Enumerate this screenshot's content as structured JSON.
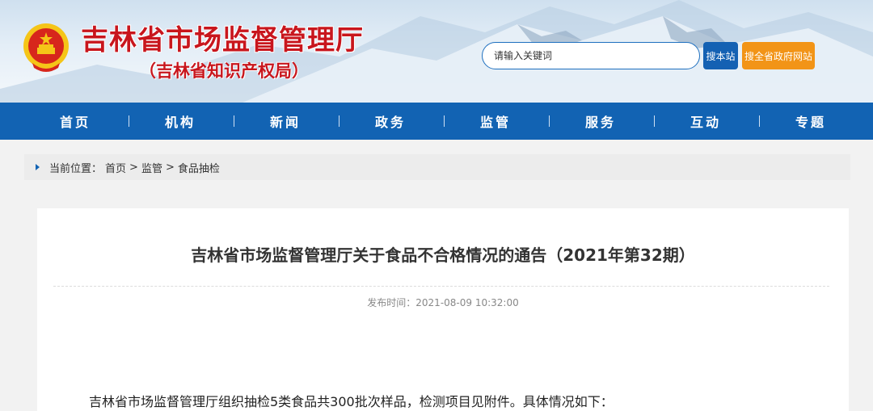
{
  "header": {
    "title": "吉林省市场监督管理厅",
    "subtitle": "（吉林省知识产权局）",
    "search_placeholder": "请输入关键词",
    "search_site_label": "搜本站",
    "search_gov_label": "搜全省政府网站"
  },
  "nav": {
    "items": [
      "首页",
      "机构",
      "新闻",
      "政务",
      "监管",
      "服务",
      "互动",
      "专题"
    ]
  },
  "breadcrumb": {
    "prefix": "当前位置：",
    "items": [
      "首页",
      "监管",
      "食品抽检"
    ],
    "separator": ">"
  },
  "article": {
    "title": "吉林省市场监督管理厅关于食品不合格情况的通告（2021年第32期）",
    "date_label": "发布时间：",
    "date": "2021-08-09 10:32:00",
    "first_paragraph": "吉林省市场监督管理厅组织抽检5类食品共300批次样品，检测项目见附件。具体情况如下："
  },
  "colors": {
    "brand_red": "#c8161d",
    "nav_blue": "#1263b3",
    "gov_button_orange": "#f29417"
  },
  "icons": {
    "emblem": "national-emblem-icon",
    "breadcrumb_marker": "triangle-right-icon"
  }
}
